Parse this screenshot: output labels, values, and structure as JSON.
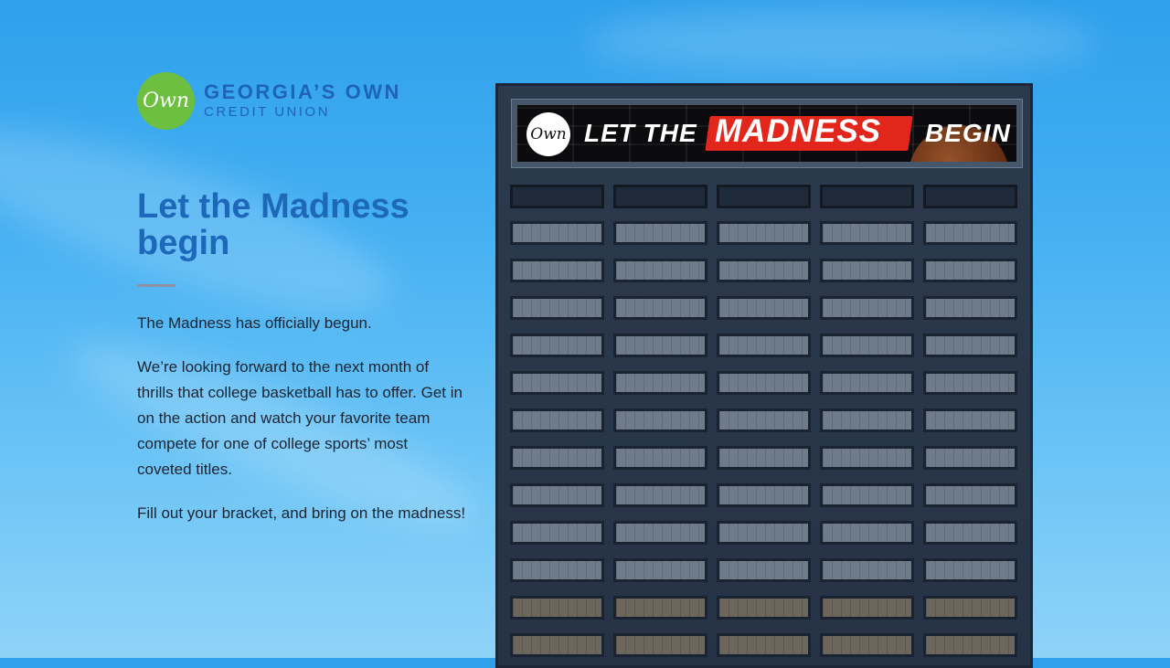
{
  "logo": {
    "mark": "Own",
    "line1": "GEORGIA’S OWN",
    "line2": "CREDIT UNION"
  },
  "headline": "Let the Madness begin",
  "paragraphs": [
    "The Madness has officially begun.",
    "We’re looking forward to the next month of thrills that college basketball has to offer. Get in on the action and watch your favorite team compete for one of college sports’ most coveted titles.",
    "Fill out your bracket, and bring on the madness!"
  ],
  "billboard": {
    "badge": "Own",
    "text_before": "LET THE",
    "text_highlight": "MADNESS",
    "text_after": "BEGIN"
  },
  "colors": {
    "brand_blue": "#1d68b8",
    "brand_green": "#6cbf3f",
    "highlight_red": "#e3261c",
    "divider": "#8f92a4"
  }
}
